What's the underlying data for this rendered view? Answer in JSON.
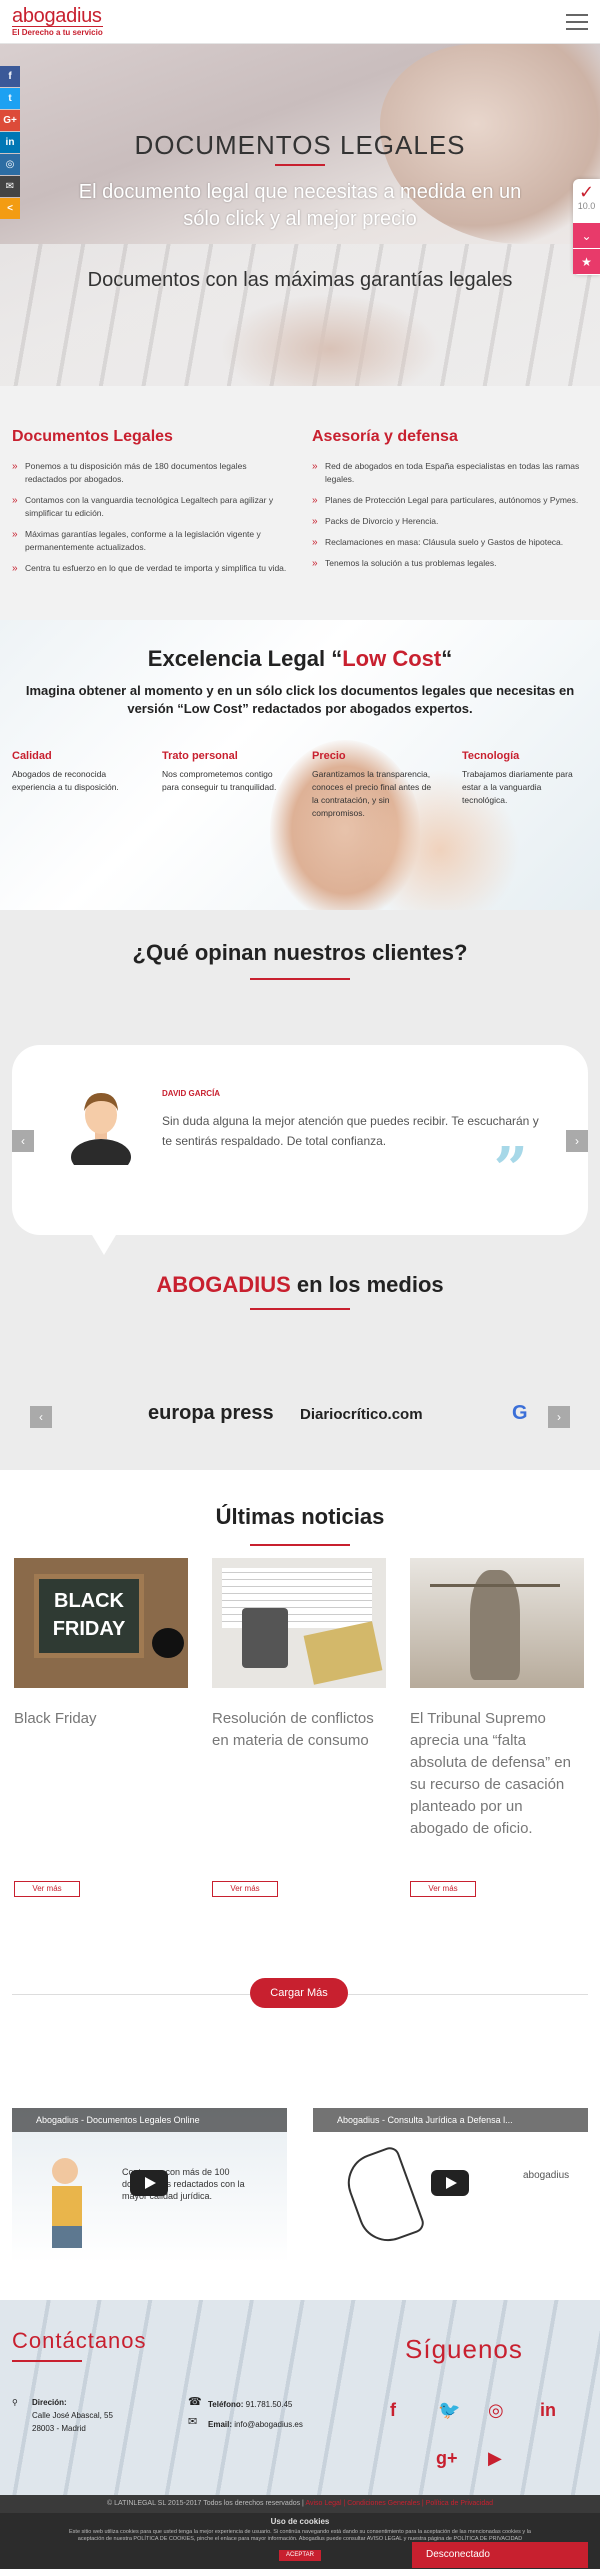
{
  "header": {
    "logo_name": "abogadius",
    "logo_tagline": "El Derecho a tu servicio"
  },
  "hero": {
    "title": "DOCUMENTOS LEGALES",
    "subtitle": "El documento legal que necesitas a medida en un sólo click y al mejor precio",
    "subtitle2": "Documentos con las máximas garantías legales"
  },
  "social_side": [
    {
      "icon": "facebook-icon",
      "label": "f",
      "color": "#3b5998"
    },
    {
      "icon": "twitter-icon",
      "label": "t",
      "color": "#1da1f2"
    },
    {
      "icon": "google-plus-icon",
      "label": "G+",
      "color": "#dd4b39"
    },
    {
      "icon": "linkedin-icon",
      "label": "in",
      "color": "#0077b5"
    },
    {
      "icon": "instagram-icon",
      "label": "◎",
      "color": "#2d6da3"
    },
    {
      "icon": "email-icon",
      "label": "✉",
      "color": "#444444"
    },
    {
      "icon": "share-icon",
      "label": "<",
      "color": "#f39c12"
    }
  ],
  "rating_widget": {
    "score": "10.0"
  },
  "services": {
    "left": {
      "title": "Documentos Legales",
      "items": [
        "Ponemos a tu disposición más de 180 documentos legales redactados por abogados.",
        "Contamos con la vanguardia tecnológica Legaltech para agilizar y simplificar tu edición.",
        "Máximas garantías legales, conforme a la legislación vigente y permanentemente actualizados.",
        "Centra tu esfuerzo en lo que de verdad te importa y simplifica tu vida."
      ]
    },
    "right": {
      "title": "Asesoría y defensa",
      "items": [
        "Red de abogados en toda España especialistas en todas las ramas legales.",
        "Planes de Protección Legal para particulares, autónomos y Pymes.",
        "Packs de Divorcio y Herencia.",
        "Reclamaciones en masa: Cláusula suelo y Gastos de hipoteca.",
        "Tenemos la solución a tus problemas legales."
      ]
    }
  },
  "lowcost": {
    "title_pre": "Excelencia Legal “",
    "title_red": "Low Cost",
    "title_post": "“",
    "subtitle": "Imagina obtener al momento y en un sólo click los documentos legales que necesitas en versión “Low Cost” redactados por abogados expertos.",
    "features": [
      {
        "title": "Calidad",
        "text": "Abogados de reconocida experiencia a tu disposición."
      },
      {
        "title": "Trato personal",
        "text": "Nos comprometemos contigo para conseguir tu tranquilidad."
      },
      {
        "title": "Precio",
        "text": "Garantizamos la transparencia, conoces el precio final antes de la contratación, y sin compromisos."
      },
      {
        "title": "Tecnología",
        "text": "Trabajamos diariamente para estar a la vanguardia tecnológica."
      }
    ]
  },
  "testimonials": {
    "title": "¿Qué opinan nuestros clientes?",
    "name": "DAVID GARCÍA",
    "quote": "Sin duda alguna la mejor atención que puedes recibir. Te escucharán y te sentirás respaldado. De total confianza.",
    "prev": "‹",
    "next": "›"
  },
  "media": {
    "title_red": "ABOGADIUS",
    "title_rest": " en los medios",
    "logos": [
      "europa press",
      "Diariocrítico.com",
      "G"
    ]
  },
  "news": {
    "title": "Últimas noticias",
    "items": [
      {
        "headline": "Black Friday",
        "image_text": "BLACK FRIDAY",
        "button": "Ver más"
      },
      {
        "headline": "Resolución de conflictos en materia de consumo",
        "image_text": "",
        "button": "Ver más"
      },
      {
        "headline": "El Tribunal Supremo aprecia una “falta absoluta de defensa” en su recurso de casación planteado por un abogado de oficio.",
        "image_text": "",
        "button": "Ver más"
      }
    ],
    "load_more": "Cargar Más"
  },
  "videos": [
    {
      "title": "Abogadius - Documentos Legales Online",
      "overlay": "Contamos con más de 100 documentos redactados con la mayor calidad jurídica."
    },
    {
      "title": "Abogadius - Consulta Jurídica a Defensa l...",
      "overlay": "abogadius"
    }
  ],
  "contact": {
    "title": "Contáctanos",
    "address_label": "Direción:",
    "address": "Calle José Abascal, 55",
    "city": "28003 - Madrid",
    "phone_label": "Teléfono:",
    "phone": "91.781.50.45",
    "email_label": "Email:",
    "email": "info@abogadius.es",
    "follow_title": "Síguenos"
  },
  "footer": {
    "copyright": "© LATINLEGAL SL 2015-2017 Todos los derechos reservados |",
    "links": "Aviso Legal | Condiciones Generales | Política de Privacidad"
  },
  "cookie": {
    "title": "Uso de cookies",
    "text": "Este sitio web utiliza cookies para que usted tenga la mejor experiencia de usuario. Si continúa navegando está dando su consentimiento para la aceptación de las mencionadas cookies y la aceptación de nuestra POLÍTICA DE COOKIES, pinche el enlace para mayor información. Abogadius puede consultar AVISO LEGAL y nuestra página de POLÍTICA DE PRIVACIDAD",
    "accept": "ACEPTAR"
  },
  "chat": {
    "status": "Desconectado"
  },
  "colors": {
    "accent": "#c8202f"
  }
}
